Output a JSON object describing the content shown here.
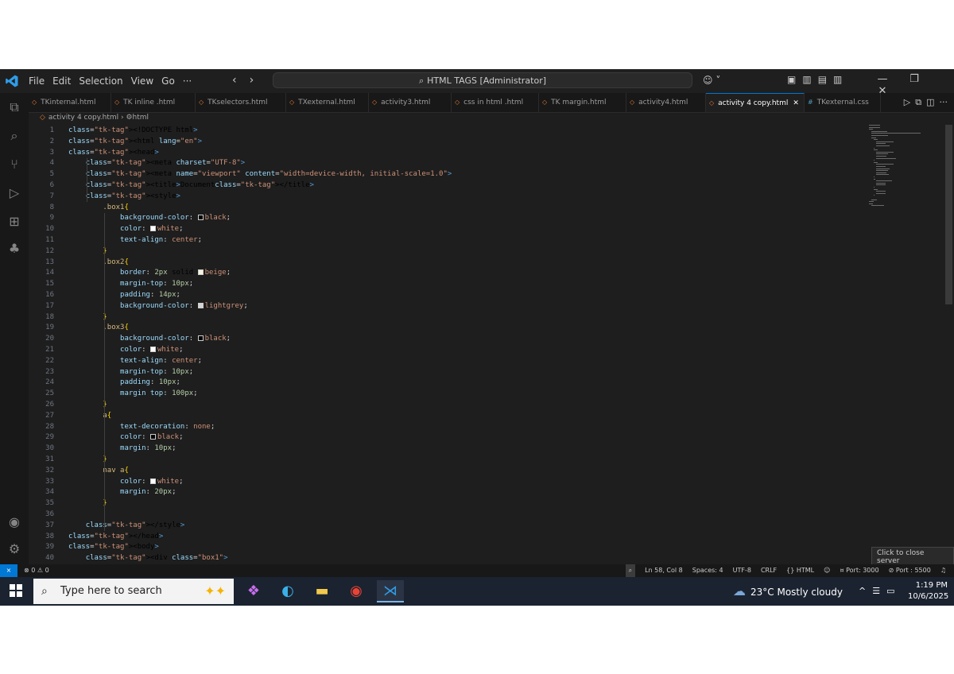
{
  "menu": [
    "File",
    "Edit",
    "Selection",
    "View",
    "Go",
    "···"
  ],
  "search": {
    "label": "HTML TAGS [Administrator]"
  },
  "tabs": [
    {
      "label": "TKinternal.html",
      "kind": "html",
      "active": false
    },
    {
      "label": "TK inline .html",
      "kind": "html",
      "active": false
    },
    {
      "label": "TKselectors.html",
      "kind": "html",
      "active": false
    },
    {
      "label": "TXexternal.html",
      "kind": "html",
      "active": false
    },
    {
      "label": "activity3.html",
      "kind": "html",
      "active": false
    },
    {
      "label": "css in html .html",
      "kind": "html",
      "active": false
    },
    {
      "label": "TK margin.html",
      "kind": "html",
      "active": false
    },
    {
      "label": "activity4.html",
      "kind": "html",
      "active": false
    },
    {
      "label": "activity 4 copy.html",
      "kind": "html",
      "active": true
    },
    {
      "label": "TKexternal.css",
      "kind": "css",
      "active": false
    }
  ],
  "breadcrumb": {
    "file": "activity 4 copy.html",
    "node": "html"
  },
  "code_lines": [
    "<!DOCTYPE html>",
    "<html lang=\"en\">",
    "<head>",
    "<meta charset=\"UTF-8\">",
    "<meta name=\"viewport\" content=\"width=device-width, initial-scale=1.0\">",
    "<title>Document</title>",
    "<style>",
    ".box1{",
    "background-color: black;",
    "color: white;",
    "text-align: center;",
    "}",
    ".box2{",
    "border: 2px solid beige;",
    "margin-top: 10px;",
    "padding: 14px;",
    "background-color: lightgrey;",
    "}",
    ".box3{",
    "background-color: black;",
    "color: white;",
    "text-align: center;",
    "margin-top: 10px;",
    "padding: 10px;",
    "margin top: 100px;",
    "}",
    "a{",
    "text-decoration: none;",
    "color: black;",
    "margin: 10px;",
    "}",
    "nav a{",
    "color: white;",
    "margin: 20px;",
    "}",
    "",
    "</style>",
    "</head>",
    "<body>",
    "<div class=\"box1\">"
  ],
  "tooltip": "Click to close server",
  "status": {
    "left": "⊗ 0 ⚠ 0",
    "items": [
      "Ln 58, Col 8",
      "Spaces: 4",
      "UTF-8",
      "CRLF",
      "{} HTML",
      "¤ Port: 3000",
      "⊘ Port : 5500"
    ]
  },
  "taskbar": {
    "search_placeholder": "Type here to search",
    "weather": "23°C  Mostly cloudy",
    "time": "1:19 PM",
    "date": "10/6/2025"
  },
  "colors": {
    "accent": "#0078d4",
    "editor_bg": "#1e1e1e",
    "html_icon": "#e37933",
    "css_icon": "#519aba"
  }
}
